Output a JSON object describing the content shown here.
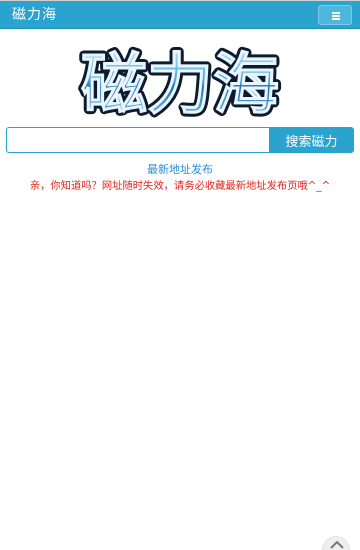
{
  "navbar": {
    "brand": "磁力海",
    "menu_icon": "hamburger-icon",
    "accent_color": "#2aa4cf"
  },
  "logo": {
    "text": "磁力海"
  },
  "search": {
    "value": "",
    "placeholder": "",
    "button_label": "搜索磁力"
  },
  "links": {
    "latest_address": "最新地址发布"
  },
  "notice": {
    "text": "亲，你知道吗？网址随时失效，请务必收藏最新地址发布页哦^_^",
    "color": "#e0261e"
  },
  "footer": {
    "back_to_top_icon": "chevron-up-icon"
  }
}
